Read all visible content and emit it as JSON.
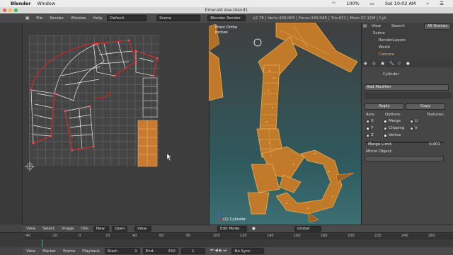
{
  "macos": {
    "apple": "",
    "app_name": "Blender",
    "menu_window": "Window",
    "clock": "Sat 10:02 AM",
    "battery": "100%"
  },
  "window": {
    "title": "Emerald Axe.blend1"
  },
  "top_header": {
    "menus": [
      "File",
      "Render",
      "Window",
      "Help"
    ],
    "layout": "Default",
    "scene": "Scene",
    "engine": "Blender Render",
    "stats": "v2.78 | Verts:405/405 | Faces:345/345 | Tris:621 | Mem:37.11M | Cyli"
  },
  "viewport": {
    "view_name": "Front Ortho",
    "units": "Inches",
    "object_label": "(1) Cylinder"
  },
  "outliner": {
    "tabs": [
      "View",
      "Search",
      "All Scenes"
    ],
    "items": [
      "Scene",
      "RenderLayers",
      "World",
      "Camera"
    ]
  },
  "properties": {
    "object": "Cylinder",
    "add_modifier": "Add Modifier",
    "apply": "Apply",
    "copy": "Copy",
    "axis_label": "Axis:",
    "options_label": "Options:",
    "textures_label": "Textures:",
    "axes": [
      "X",
      "Y",
      "Z"
    ],
    "options": [
      "Merge",
      "Clipping",
      "Vertex"
    ],
    "texture_opts": [
      "U",
      "V"
    ],
    "merge_limit_label": "Merge Limit:",
    "merge_limit_value": "0.001",
    "mirror_object_label": "Mirror Object:"
  },
  "uv_header": {
    "menus": [
      "View",
      "Select",
      "Image",
      "UVs"
    ],
    "new_button": "New",
    "open_button": "Open",
    "view_mode": "View"
  },
  "v3d_header": {
    "mode": "Edit Mode",
    "orientation": "Global"
  },
  "timeline": {
    "ticks": [
      "-40",
      "-20",
      "0",
      "20",
      "40",
      "60",
      "80",
      "100",
      "120",
      "140",
      "160",
      "180",
      "200",
      "220",
      "240",
      "260"
    ],
    "menus": [
      "View",
      "Marker",
      "Frame",
      "Playback"
    ],
    "start_label": "Start:",
    "start": "1",
    "end_label": "End:",
    "end": "250",
    "current": "1",
    "sync": "No Sync"
  }
}
